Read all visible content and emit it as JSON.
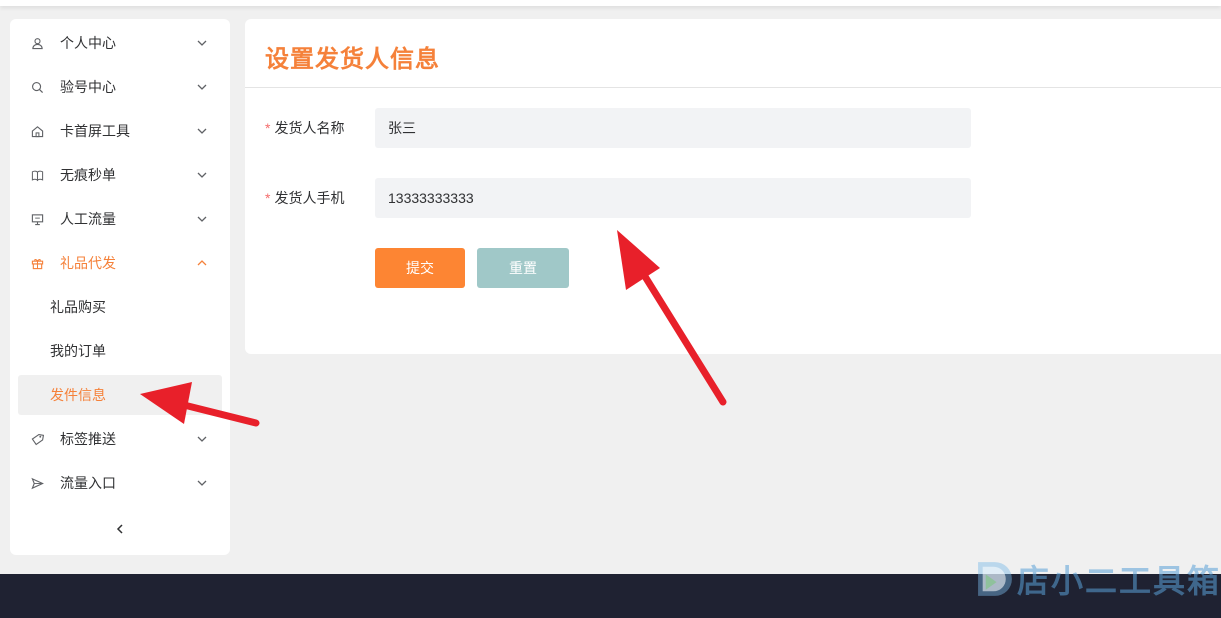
{
  "sidebar": {
    "items": [
      {
        "label": "个人中心",
        "icon": "user-icon"
      },
      {
        "label": "验号中心",
        "icon": "search-icon"
      },
      {
        "label": "卡首屏工具",
        "icon": "home-icon"
      },
      {
        "label": "无痕秒单",
        "icon": "book-icon"
      },
      {
        "label": "人工流量",
        "icon": "monitor-icon"
      },
      {
        "label": "礼品代发",
        "icon": "gift-icon",
        "expanded": true
      },
      {
        "label": "标签推送",
        "icon": "tag-icon"
      },
      {
        "label": "流量入口",
        "icon": "send-icon"
      }
    ],
    "sub_items": [
      {
        "label": "礼品购买"
      },
      {
        "label": "我的订单"
      },
      {
        "label": "发件信息",
        "selected": true
      }
    ]
  },
  "main": {
    "title": "设置发货人信息",
    "form": {
      "name_label": "发货人名称",
      "name_value": "张三",
      "phone_label": "发货人手机",
      "phone_value": "13333333333",
      "required_mark": "*"
    },
    "buttons": {
      "submit": "提交",
      "reset": "重置"
    }
  },
  "watermark": {
    "text": "店小二工具箱"
  },
  "colors": {
    "accent": "#f5813a",
    "submit_button": "#fd8533",
    "reset_button": "#a0c8c8",
    "footer": "#1f2232",
    "required": "#f56c6c",
    "arrow": "#e8202a"
  }
}
